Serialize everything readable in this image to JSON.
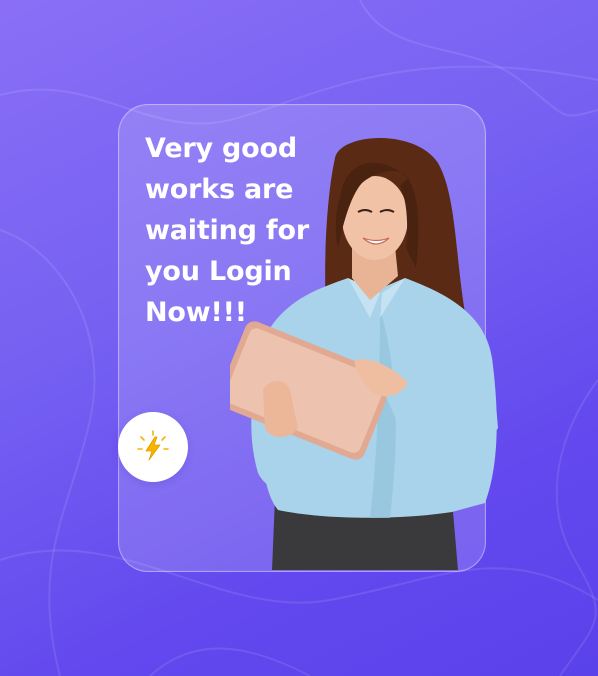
{
  "card": {
    "headline": "Very good works are waiting for you Login Now!!!"
  },
  "badge": {
    "icon": "lightning-bolt-icon",
    "color": "#f5b400"
  },
  "illustration": {
    "subject": "woman-using-tablet"
  },
  "colors": {
    "background_start": "#8a6ff6",
    "background_end": "#5a41ea",
    "text": "#ffffff"
  }
}
